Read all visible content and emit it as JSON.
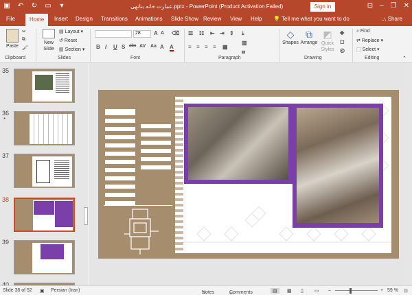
{
  "window": {
    "title": "عمارت خانه بنا‌نهی.pptx - PowerPoint (Product Activation Failed)",
    "signin": "Sign in",
    "controls": [
      "–",
      "❐",
      "✕"
    ]
  },
  "tabs": [
    "File",
    "Home",
    "Insert",
    "Design",
    "Transitions",
    "Animations",
    "Slide Show",
    "Review",
    "View",
    "Help"
  ],
  "active_tab": "Home",
  "tellme": "Tell me what you want to do",
  "share": "Share",
  "ribbon": {
    "clipboard": {
      "label": "Clipboard",
      "paste": "Paste"
    },
    "slides": {
      "label": "Slides",
      "new_slide": "New Slide",
      "layout": "Layout",
      "reset": "Reset",
      "section": "Section"
    },
    "font": {
      "label": "Font",
      "size": "28",
      "styles": [
        "B",
        "I",
        "U",
        "S",
        "abc",
        "AV",
        "Aa",
        "A",
        "A"
      ]
    },
    "paragraph": {
      "label": "Paragraph"
    },
    "drawing": {
      "label": "Drawing",
      "shapes": "Shapes",
      "arrange": "Arrange",
      "quick_styles": "Quick Styles"
    },
    "editing": {
      "label": "Editing",
      "find": "Find",
      "replace": "Replace",
      "select": "Select"
    }
  },
  "thumbnails": [
    {
      "num": "35",
      "star": ""
    },
    {
      "num": "36",
      "star": "*"
    },
    {
      "num": "37",
      "star": ""
    },
    {
      "num": "38",
      "star": ""
    },
    {
      "num": "39",
      "star": ""
    },
    {
      "num": "40",
      "star": ""
    }
  ],
  "current_slide_index": 3,
  "status": {
    "slide_info": "Slide 38 of 52",
    "language": "Persian (Iran)",
    "notes": "Notes",
    "comments": "Comments",
    "zoom": "59 %",
    "zoom_minus": "–",
    "zoom_plus": "+"
  },
  "colors": {
    "accent": "#b7472a",
    "slide_bg": "#a68d6d",
    "frame": "#7a3fa8"
  }
}
